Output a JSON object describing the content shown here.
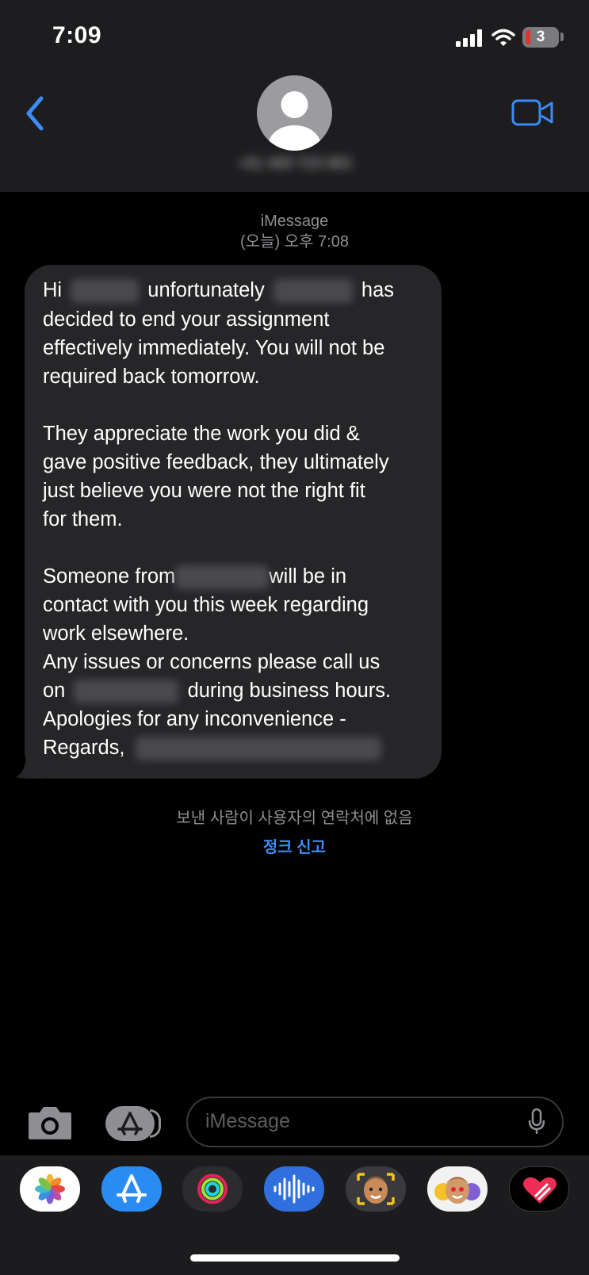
{
  "status_bar": {
    "time": "7:09",
    "battery_level": "3"
  },
  "header": {
    "contact_name": "+61 400 723 063"
  },
  "conversation": {
    "service": "iMessage",
    "timestamp": "(오늘) 오후 7:08",
    "message": {
      "p1_l1_a": "Hi",
      "p1_l1_b": "unfortunately",
      "p1_l1_c": "has",
      "p1_l2": "decided to end your assignment",
      "p1_l3": "effectively immediately. You will not be",
      "p1_l4": "required back tomorrow.",
      "p2_l1": "They appreciate the work you did &",
      "p2_l2": "gave positive feedback, they ultimately",
      "p2_l3": "just believe you were not the right fit",
      "p2_l4": "for them.",
      "p3_l1_a": "Someone from",
      "p3_l1_b": "will be in",
      "p3_l2": "contact with you this week regarding",
      "p3_l3": "work elsewhere.",
      "p3_l4": "Any issues or concerns please call us",
      "p3_l5_a": "on",
      "p3_l5_b": "during business hours.",
      "p3_l6": "Apologies for any inconvenience -",
      "p3_l7": "Regards,"
    },
    "unknown_sender_notice": "보낸 사람이 사용자의 연락처에 없음",
    "report_junk_label": "정크 신고"
  },
  "input": {
    "placeholder": "iMessage"
  },
  "app_drawer": {
    "apps": [
      "photos-icon",
      "app-store-icon",
      "activity-icon",
      "audio-message-icon",
      "memoji-icon",
      "memoji-stickers-icon",
      "digital-touch-icon"
    ]
  },
  "colors": {
    "accent": "#3b8cf7",
    "header_bg": "#1d1d1f",
    "bubble_bg": "#262628",
    "background": "#000000"
  }
}
